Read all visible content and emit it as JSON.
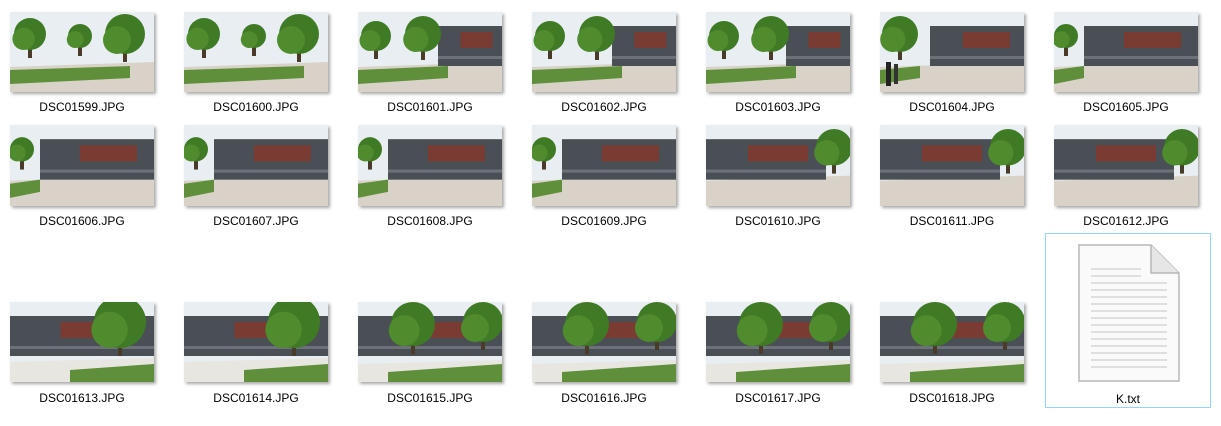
{
  "files": [
    {
      "name": "DSC01599.JPG",
      "scene": "trees-left"
    },
    {
      "name": "DSC01600.JPG",
      "scene": "trees-left"
    },
    {
      "name": "DSC01601.JPG",
      "scene": "trees-building"
    },
    {
      "name": "DSC01602.JPG",
      "scene": "trees-building"
    },
    {
      "name": "DSC01603.JPG",
      "scene": "trees-building"
    },
    {
      "name": "DSC01604.JPG",
      "scene": "building-people"
    },
    {
      "name": "DSC01605.JPG",
      "scene": "building"
    },
    {
      "name": "DSC01606.JPG",
      "scene": "building"
    },
    {
      "name": "DSC01607.JPG",
      "scene": "building"
    },
    {
      "name": "DSC01608.JPG",
      "scene": "building"
    },
    {
      "name": "DSC01609.JPG",
      "scene": "building"
    },
    {
      "name": "DSC01610.JPG",
      "scene": "building-tree"
    },
    {
      "name": "DSC01611.JPG",
      "scene": "building-tree"
    },
    {
      "name": "DSC01612.JPG",
      "scene": "building-tree"
    },
    {
      "name": "DSC01613.JPG",
      "scene": "big-tree"
    },
    {
      "name": "DSC01614.JPG",
      "scene": "big-tree"
    },
    {
      "name": "DSC01615.JPG",
      "scene": "two-trees"
    },
    {
      "name": "DSC01616.JPG",
      "scene": "two-trees"
    },
    {
      "name": "DSC01617.JPG",
      "scene": "two-trees"
    },
    {
      "name": "DSC01618.JPG",
      "scene": "two-trees"
    }
  ],
  "text_file": {
    "name": "K.txt",
    "icon": "text-document-icon",
    "selected": true
  },
  "colors": {
    "selection_border": "#99d1ff",
    "sky": "#e9eef2",
    "building": "#4a4f55",
    "brick": "#7a3b32",
    "tree": "#3f7a25",
    "grass": "#5f8f3a",
    "pavement": "#d8d2c8"
  }
}
